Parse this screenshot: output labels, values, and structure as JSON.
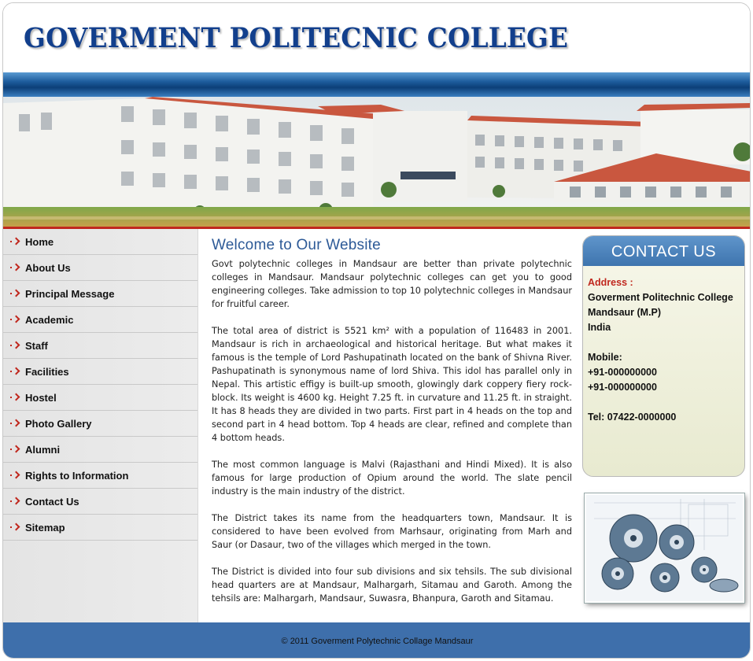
{
  "header": {
    "title": "GOVERMENT POLITECNIC COLLEGE"
  },
  "banner": {
    "image": "college-building-photo"
  },
  "sidebar": {
    "items": [
      {
        "label": "Home"
      },
      {
        "label": "About Us"
      },
      {
        "label": "Principal Message"
      },
      {
        "label": "Academic"
      },
      {
        "label": "Staff"
      },
      {
        "label": "Facilities"
      },
      {
        "label": "Hostel"
      },
      {
        "label": "Photo Gallery"
      },
      {
        "label": "Alumni"
      },
      {
        "label": "Rights to Information"
      },
      {
        "label": "Contact Us"
      },
      {
        "label": "Sitemap"
      }
    ]
  },
  "main": {
    "heading": "Welcome to Our Website",
    "paragraphs": [
      "Govt polytechnic colleges in Mandsaur are better than private polytechnic colleges in Mandsaur. Mandsaur polytechnic colleges can get you to good engineering colleges. Take admission to top 10 polytechnic colleges in Mandsaur for fruitful career.",
      "The total area of district is 5521 km² with a population of 116483 in 2001. Mandsaur is rich in archaeological and historical heritage. But what makes it famous is the temple of Lord Pashupatinath located on the bank of Shivna River. Pashupatinath is synonymous name of lord Shiva. This idol has parallel only in Nepal. This artistic effigy is built-up smooth, glowingly dark coppery fiery rock-block. Its weight is 4600 kg. Height 7.25 ft. in curvature and 11.25 ft. in straight. It has 8 heads they are divided in two parts. First part in 4 heads on the top and second part in 4 head bottom. Top 4 heads are clear, refined and complete than 4 bottom heads.",
      "The most common language is Malvi (Rajasthani and Hindi Mixed).  It is also famous for large production of Opium around the world. The slate pencil industry is the main industry of the district.",
      "The District takes its name from the headquarters town, Mandsaur. It is considered to have been evolved from Marhsaur, originating from Marh and Saur (or Dasaur, two of the villages which merged in the town.",
      "The District is divided into four sub divisions and six tehsils. The sub divisional head quarters are at Mandsaur, Malhargarh, Sitamau and Garoth. Among the tehsils are: Malhargarh, Mandsaur, Suwasra, Bhanpura, Garoth and Sitamau."
    ]
  },
  "contact": {
    "heading": "CONTACT US",
    "address_label": "Address :",
    "address_lines": [
      "Goverment Politechnic College",
      "Mandsaur (M.P)",
      "India"
    ],
    "mobile_label": "Mobile:",
    "mobile_numbers": [
      "+91-000000000",
      "+91-000000000"
    ],
    "tel": "Tel: 07422-0000000"
  },
  "side_image": {
    "image": "mechanical-gears-illustration"
  },
  "footer": {
    "text": "© 2011 Goverment Polytechnic Collage Mandsaur"
  },
  "colors": {
    "title_blue": "#123f8c",
    "nav_arrow_red": "#c0281e",
    "heading_blue": "#2d5a97",
    "footer_blue": "#3e6fab"
  }
}
